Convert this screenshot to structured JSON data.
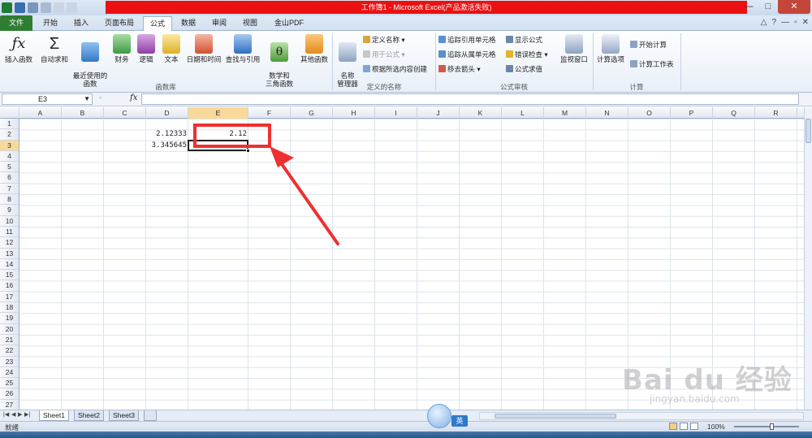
{
  "window": {
    "title": "工作簿1 - Microsoft Excel(产品激活失败)",
    "controls": [
      "—",
      "□",
      "✕"
    ]
  },
  "tabs": [
    "文件",
    "开始",
    "插入",
    "页面布局",
    "公式",
    "数据",
    "审阅",
    "视图",
    "金山PDF"
  ],
  "active_tab": "公式",
  "ribbon": {
    "function_library": {
      "label": "函数库",
      "insert_function": "插入函数",
      "autosum": "自动求和",
      "recent": "最近使用的\n函数",
      "financial": "财务",
      "logical": "逻辑",
      "text": "文本",
      "datetime": "日期和时间",
      "lookup": "查找与引用",
      "math": "数学和\n三角函数",
      "more": "其他函数"
    },
    "defined_names": {
      "label": "定义的名称",
      "name_manager": "名称\n管理器",
      "define_name": "定义名称 ▾",
      "use_in_formula": "用于公式 ▾",
      "create_from_selection": "根据所选内容创建"
    },
    "formula_auditing": {
      "label": "公式审核",
      "trace_precedents": "追踪引用单元格",
      "trace_dependents": "追踪从属单元格",
      "remove_arrows": "移去箭头 ▾",
      "show_formulas": "显示公式",
      "error_checking": "错误检查 ▾",
      "evaluate_formula": "公式求值",
      "watch_window": "监视窗口"
    },
    "calculation": {
      "label": "计算",
      "calc_options": "计算选项",
      "calc_now": "开始计算",
      "calc_sheet": "计算工作表"
    }
  },
  "formula_bar": {
    "name_box": "E3",
    "fx": "fx",
    "formula": ""
  },
  "grid": {
    "columns": [
      "A",
      "B",
      "C",
      "D",
      "E",
      "F",
      "G",
      "H",
      "I",
      "J",
      "K",
      "L",
      "M",
      "N",
      "O",
      "P",
      "Q",
      "R"
    ],
    "rows": [
      "1",
      "2",
      "3",
      "4",
      "5",
      "6",
      "7",
      "8",
      "9",
      "10",
      "11",
      "12",
      "13",
      "14",
      "15",
      "16",
      "17",
      "18",
      "19",
      "20",
      "21",
      "22",
      "23",
      "24",
      "25",
      "26",
      "27"
    ],
    "selected_column": "E",
    "selected_row": "3",
    "cells": {
      "D2": "2.12333",
      "E2": "2.12",
      "D3": "3.345645"
    }
  },
  "sheets": [
    "Sheet1",
    "Sheet2",
    "Sheet3"
  ],
  "active_sheet": "Sheet1",
  "status": {
    "ready": "就绪",
    "zoom": "100%",
    "zoom_level_percent": 100
  },
  "ime": {
    "lang": "英"
  },
  "watermark": {
    "brand": "Bai du 经验",
    "url": "jingyan.baidu.com"
  },
  "colors": {
    "title_red": "#ec1111",
    "file_tab": "#2f7d32",
    "annotation_red": "#ee3030",
    "selection_header": "#f9d99a"
  }
}
